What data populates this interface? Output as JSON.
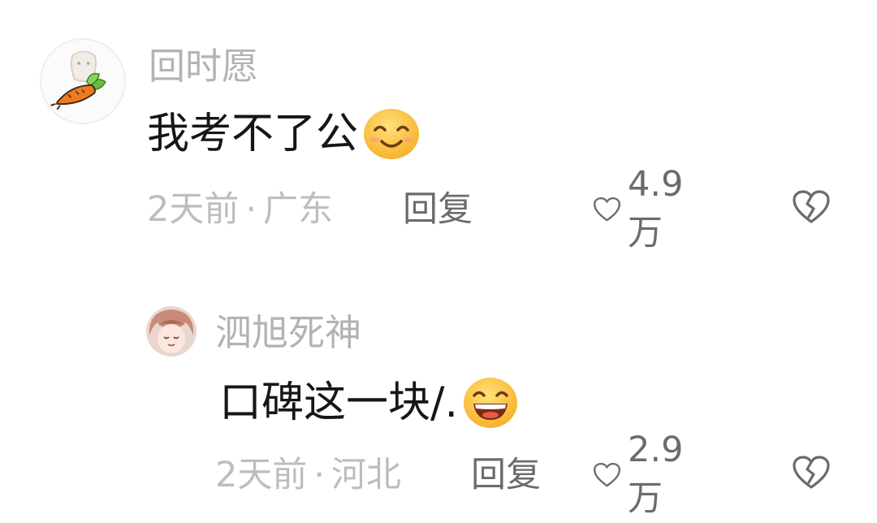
{
  "comments": [
    {
      "username": "回时愿",
      "text": "我考不了公",
      "emoji": "smiling-face-emoji",
      "time": "2天前",
      "separator": "·",
      "location": "广东",
      "reply_label": "回复",
      "likes": "4.9万"
    },
    {
      "username": "泗旭死神",
      "text": "口碑这一块/.",
      "emoji": "grinning-face-emoji",
      "time": "2天前",
      "separator": "·",
      "location": "河北",
      "reply_label": "回复",
      "likes": "2.9万"
    }
  ],
  "icons": {
    "like": "heart-outline-icon",
    "dislike": "broken-heart-icon"
  },
  "colors": {
    "username": "#b3b3b3",
    "meta": "#bdbdbd",
    "action": "#6b6b6b",
    "emoji_face": "#ffc83d"
  }
}
